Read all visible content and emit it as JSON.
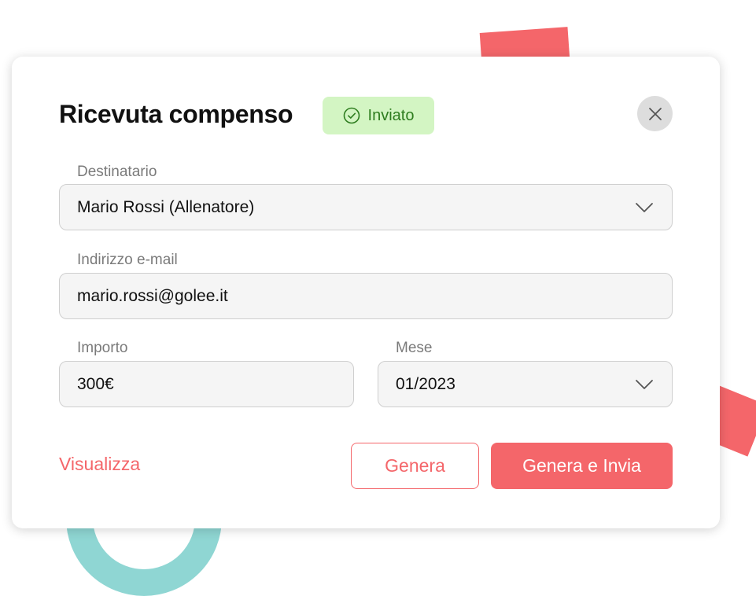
{
  "modal": {
    "title": "Ricevuta compenso",
    "status_badge": "Inviato"
  },
  "form": {
    "recipient": {
      "label": "Destinatario",
      "value": "Mario Rossi (Allenatore)"
    },
    "email": {
      "label": "Indirizzo e-mail",
      "value": "mario.rossi@golee.it"
    },
    "amount": {
      "label": "Importo",
      "value": "300€"
    },
    "month": {
      "label": "Mese",
      "value": "01/2023"
    }
  },
  "actions": {
    "view_link": "Visualizza",
    "generate_button": "Genera",
    "generate_send_button": "Genera e Invia"
  },
  "icons": {
    "badge": "check-circle-icon",
    "close": "close-icon",
    "dropdown": "chevron-down-icon"
  },
  "colors": {
    "accent": "#f4666a",
    "success_bg": "#d3f5c3",
    "success_text": "#2e7d1f",
    "decor_teal": "#8fd6d3"
  }
}
